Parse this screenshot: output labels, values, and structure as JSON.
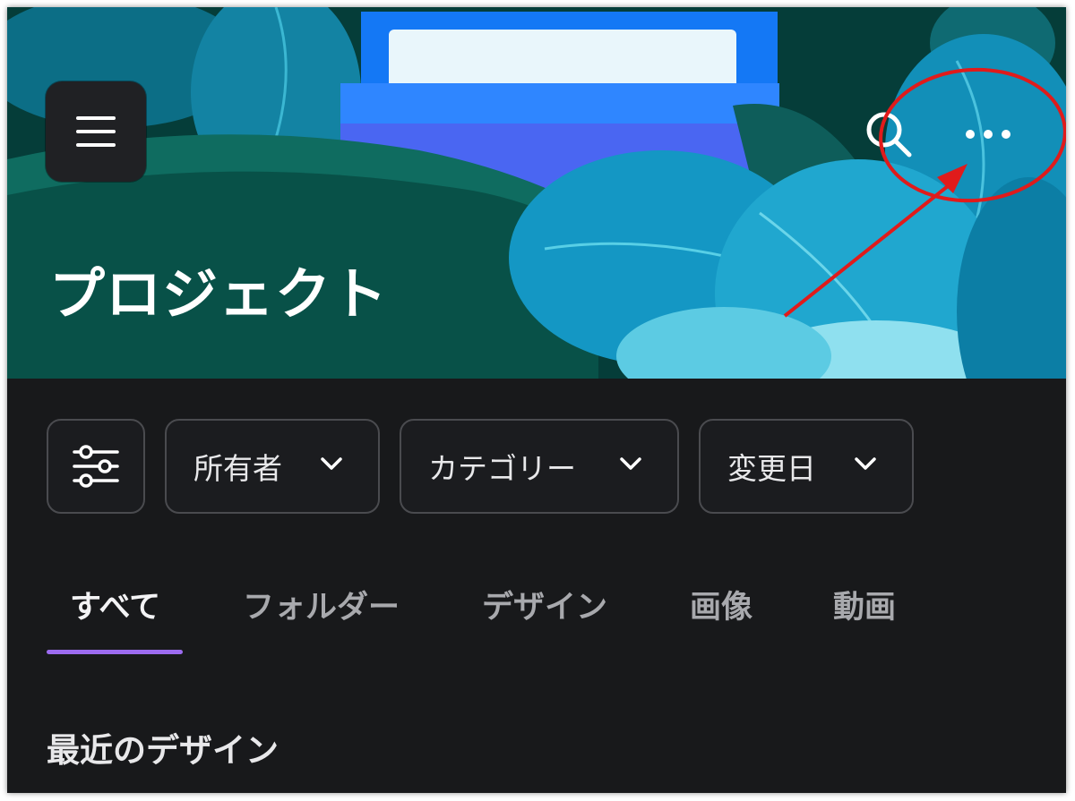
{
  "header": {
    "title": "プロジェクト",
    "menu_icon": "hamburger-menu-icon",
    "search_icon": "search-icon",
    "more_icon": "more-horizontal-icon"
  },
  "filters": {
    "adjust_icon": "sliders-icon",
    "chips": [
      {
        "label": "所有者",
        "icon": "chevron-down-icon"
      },
      {
        "label": "カテゴリー",
        "icon": "chevron-down-icon"
      },
      {
        "label": "変更日",
        "icon": "chevron-down-icon"
      }
    ]
  },
  "tabs": [
    {
      "label": "すべて",
      "active": true
    },
    {
      "label": "フォルダー",
      "active": false
    },
    {
      "label": "デザイン",
      "active": false
    },
    {
      "label": "画像",
      "active": false
    },
    {
      "label": "動画",
      "active": false
    }
  ],
  "section": {
    "title": "最近のデザイン"
  },
  "colors": {
    "background": "#18191b",
    "tab_indicator": "#9c6bf0",
    "annotation": "#e01b1b",
    "hero_dark": "#053d39",
    "hero_blue": "#1f86ff"
  }
}
